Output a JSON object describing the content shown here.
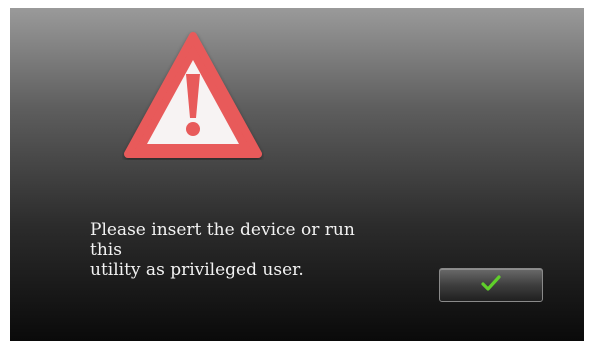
{
  "dialog": {
    "icon": "warning-triangle-icon",
    "message_lines": [
      "Please insert the device or run",
      "this",
      "utility as privileged user."
    ],
    "ok_button": {
      "icon": "checkmark-icon"
    }
  },
  "colors": {
    "warning_red": "#e85a5a",
    "warning_fill": "#f7f3f3",
    "check_green": "#5fcf2a"
  }
}
